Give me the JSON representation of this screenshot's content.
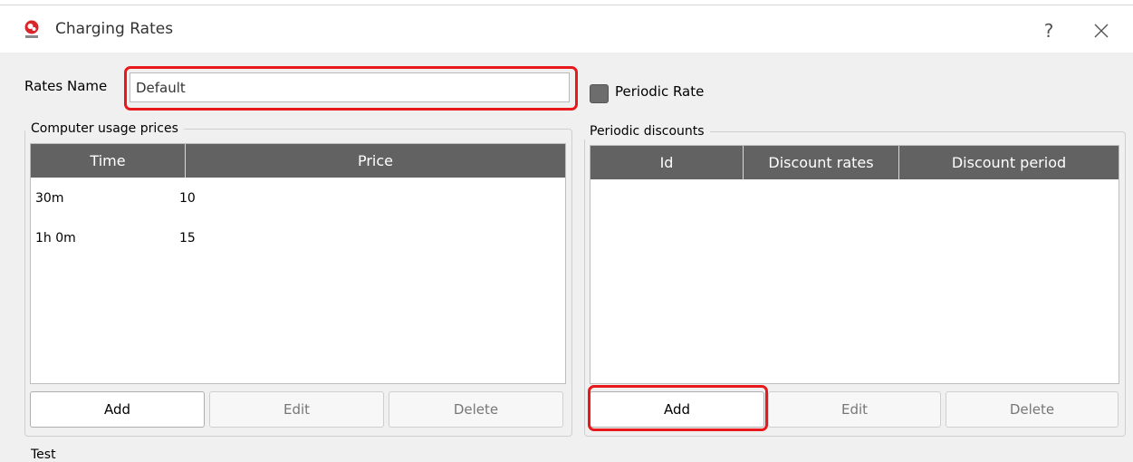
{
  "window": {
    "title": "Charging Rates",
    "help_glyph": "?",
    "icons": {
      "app": "app-logo-icon",
      "close": "close-icon"
    }
  },
  "rates": {
    "label": "Rates Name",
    "value": "Default"
  },
  "periodic": {
    "label": "Periodic Rate",
    "checked": false
  },
  "usage": {
    "title": "Computer usage prices",
    "columns": [
      "Time",
      "Price"
    ],
    "rows": [
      [
        "30m",
        "10"
      ],
      [
        "1h 0m",
        "15"
      ]
    ],
    "buttons": {
      "add": "Add",
      "edit": "Edit",
      "delete": "Delete"
    }
  },
  "discounts": {
    "title": "Periodic discounts",
    "columns": [
      "Id",
      "Discount rates",
      "Discount period"
    ],
    "rows": [],
    "buttons": {
      "add": "Add",
      "edit": "Edit",
      "delete": "Delete"
    }
  },
  "next_group": {
    "title": "Test"
  },
  "colors": {
    "header": "#626262",
    "highlight": "#e8191c",
    "brand": "#d9262b"
  }
}
